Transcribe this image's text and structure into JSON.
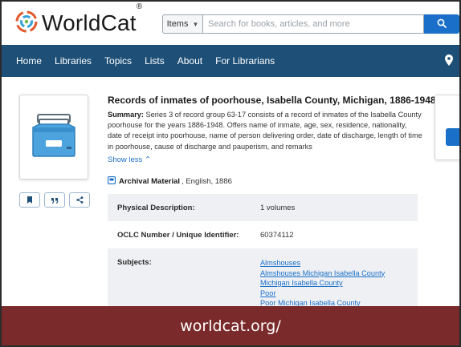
{
  "header": {
    "brand": "WorldCat",
    "brand_mark": "®",
    "search": {
      "scope": "Items",
      "placeholder": "Search for books, articles, and more"
    },
    "colors": {
      "accent": "#1a6fc9",
      "nav_bg": "#1d4f77"
    }
  },
  "nav": {
    "items": [
      "Home",
      "Libraries",
      "Topics",
      "Lists",
      "About",
      "For Librarians"
    ]
  },
  "record": {
    "title": "Records of inmates of poorhouse, Isabella County, Michigan, 1886-1948",
    "summary_label": "Summary:",
    "summary_text": "Series 3 of record group 63-17 consists of a record of inmates of the Isabella County poorhouse for the years 1886-1948. Offers name of inmate, age, sex, residence, nationality, date of receipt into poorhouse, name of person delivering order, date of discharge, length of time in poorhouse, cause of discharge and pauperism, and remarks",
    "show_less": "Show less",
    "format_type": "Archival Material",
    "format_rest": ", English, 1886",
    "details": [
      {
        "label": "Physical Description:",
        "value": "1 volumes"
      },
      {
        "label": "OCLC Number / Unique Identifier:",
        "value": "60374112"
      }
    ],
    "subjects_label": "Subjects:",
    "subjects": [
      "Almshouses",
      "Almshouses Michigan Isabella County",
      "Michigan Isabella County",
      "Poor",
      "Poor Michigan Isabella County"
    ]
  },
  "banner": {
    "text": "worldcat.org/",
    "color": "#7a2a2a"
  }
}
